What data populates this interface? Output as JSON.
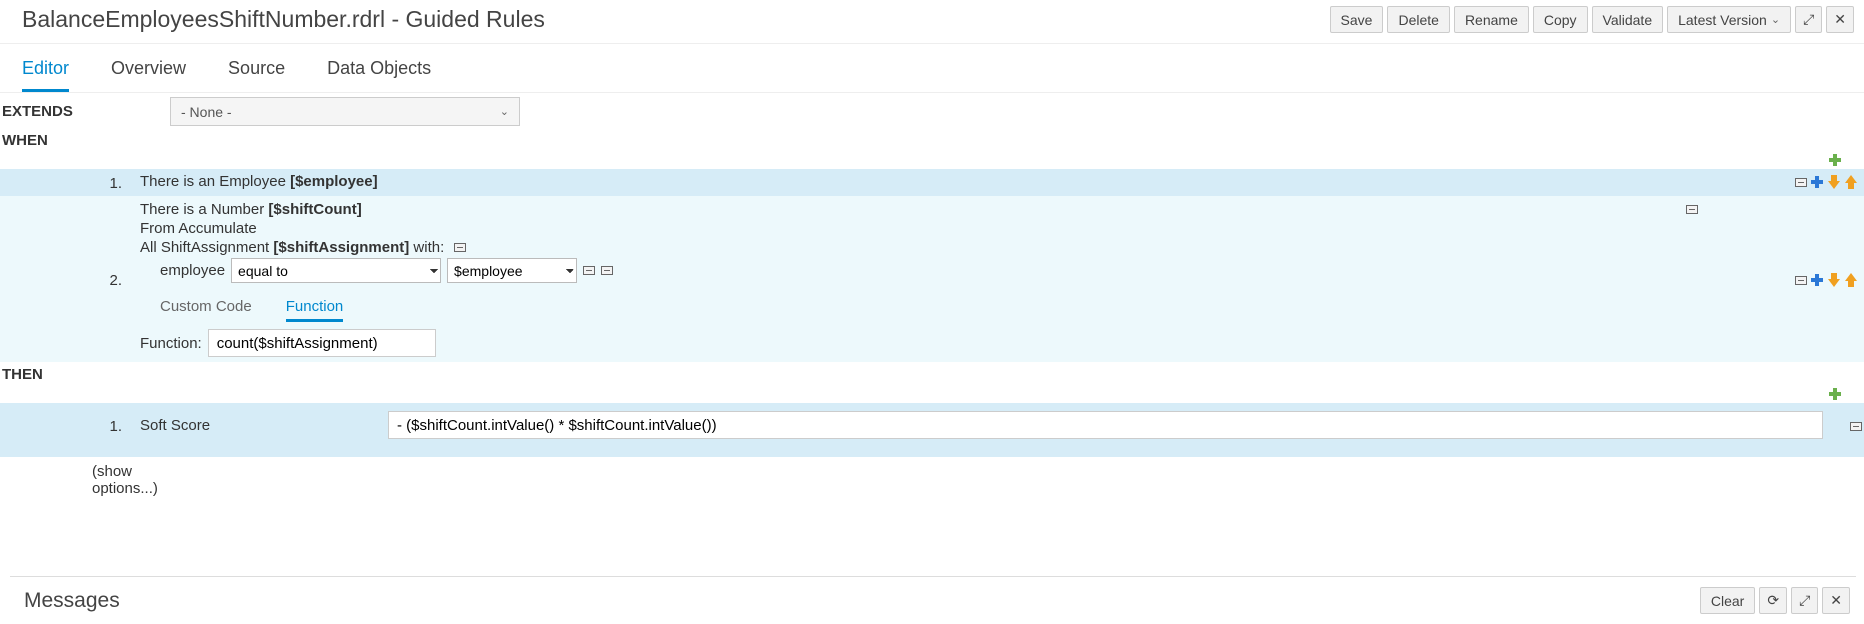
{
  "header": {
    "title": "BalanceEmployeesShiftNumber.rdrl - Guided Rules",
    "buttons": {
      "save": "Save",
      "delete": "Delete",
      "rename": "Rename",
      "copy": "Copy",
      "validate": "Validate",
      "version": "Latest Version"
    }
  },
  "tabs": {
    "editor": "Editor",
    "overview": "Overview",
    "source": "Source",
    "data_objects": "Data Objects"
  },
  "extends": {
    "label": "EXTENDS",
    "value": "- None -"
  },
  "when": {
    "label": "WHEN",
    "items": [
      {
        "num": "1.",
        "text_prefix": "There is an Employee ",
        "binding": "[$employee]"
      },
      {
        "num": "2.",
        "line1_prefix": "There is a Number ",
        "line1_binding": "[$shiftCount]",
        "line2": "From Accumulate",
        "line3_prefix": "All ShiftAssignment ",
        "line3_binding": "[$shiftAssignment]",
        "line3_suffix": " with:",
        "constraint_field": "employee",
        "constraint_op": "equal to",
        "constraint_value": "$employee",
        "sub_tabs": {
          "custom": "Custom Code",
          "function": "Function"
        },
        "func_label": "Function:",
        "func_value": "count($shiftAssignment)"
      }
    ]
  },
  "then": {
    "label": "THEN",
    "items": [
      {
        "num": "1.",
        "label": "Soft Score",
        "value": "- ($shiftCount.intValue() * $shiftCount.intValue())"
      }
    ],
    "show_options": "(show options...)"
  },
  "messages": {
    "title": "Messages",
    "clear": "Clear"
  }
}
